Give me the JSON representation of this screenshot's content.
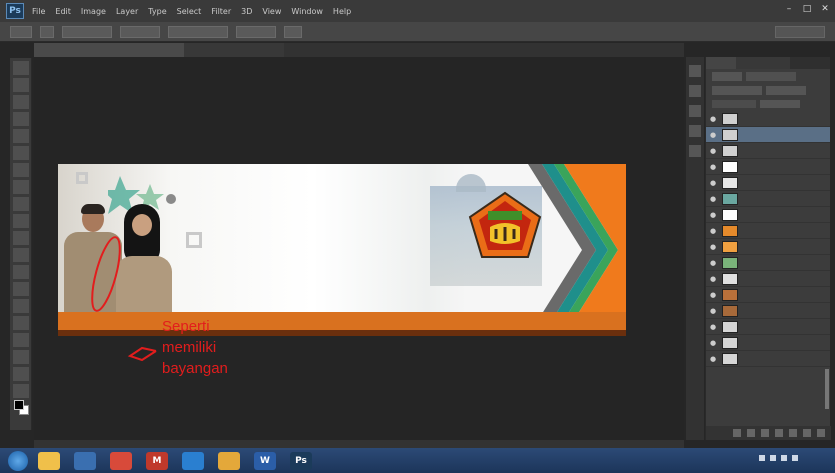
{
  "app": {
    "logo_label": "Ps",
    "menu": [
      "File",
      "Edit",
      "Image",
      "Layer",
      "Type",
      "Select",
      "Filter",
      "3D",
      "View",
      "Window",
      "Help"
    ],
    "window_controls": [
      "–",
      "□",
      "✕"
    ]
  },
  "document": {
    "tab_active": "",
    "tab_inactive": ""
  },
  "banner": {
    "colors": {
      "orange": "#f07a1c",
      "band": "#d9711f",
      "teal": "#1f8f8b",
      "green": "#3aa45b"
    }
  },
  "annotation": {
    "lines": [
      "Seperti",
      "memiliki",
      "bayangan"
    ],
    "color": "#e21d1d"
  },
  "layers_panel": {
    "tabs": [
      "",
      "",
      ""
    ],
    "layers": [
      {
        "name": "",
        "thumb": "#d0d0d0",
        "selected": false
      },
      {
        "name": "",
        "thumb": "#d0d0d0",
        "selected": true
      },
      {
        "name": "",
        "thumb": "#d0d0d0",
        "selected": false
      },
      {
        "name": "",
        "thumb": "#ffffff",
        "selected": false
      },
      {
        "name": "",
        "thumb": "#e6e6e6",
        "selected": false
      },
      {
        "name": "",
        "thumb": "#6aa7a0",
        "selected": false
      },
      {
        "name": "",
        "thumb": "#ffffff",
        "selected": false
      },
      {
        "name": "",
        "thumb": "#e58a2b",
        "selected": false
      },
      {
        "name": "",
        "thumb": "#f0a040",
        "selected": false
      },
      {
        "name": "",
        "thumb": "#7ab37a",
        "selected": false
      },
      {
        "name": "",
        "thumb": "#e0e0e0",
        "selected": false
      },
      {
        "name": "",
        "thumb": "#b9703a",
        "selected": false
      },
      {
        "name": "",
        "thumb": "#a86a3a",
        "selected": false
      },
      {
        "name": "",
        "thumb": "#d6d6d6",
        "selected": false
      },
      {
        "name": "",
        "thumb": "#d6d6d6",
        "selected": false
      },
      {
        "name": "",
        "thumb": "#d6d6d6",
        "selected": false
      }
    ]
  },
  "taskbar": {
    "apps": [
      {
        "icon": "explorer-icon",
        "color": "#f0c04a",
        "label": ""
      },
      {
        "icon": "media-icon",
        "color": "#3a6fb0",
        "label": ""
      },
      {
        "icon": "chrome-icon",
        "color": "#d84a3a",
        "label": ""
      },
      {
        "icon": "gmail-icon",
        "color": "#c0392b",
        "label": "M"
      },
      {
        "icon": "browser-icon",
        "color": "#2a7fd0",
        "label": ""
      },
      {
        "icon": "folder-icon",
        "color": "#e4a83a",
        "label": ""
      },
      {
        "icon": "word-icon",
        "color": "#2b5ea8",
        "label": "W"
      },
      {
        "icon": "photoshop-icon",
        "color": "#1b3b5a",
        "label": "Ps"
      }
    ]
  }
}
